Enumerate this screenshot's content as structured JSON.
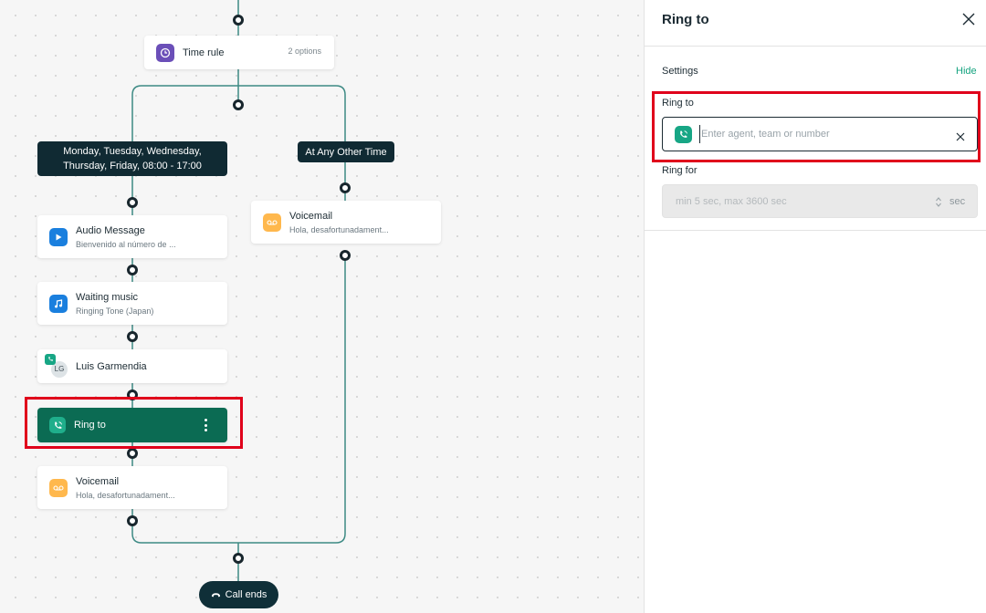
{
  "flow": {
    "time_rule": {
      "title": "Time rule",
      "meta": "2 options"
    },
    "branches": [
      {
        "label_line1": "Monday, Tuesday, Wednesday,",
        "label_line2": "Thursday, Friday, 08:00 - 17:00"
      },
      {
        "label": "At Any Other Time"
      }
    ],
    "steps": [
      {
        "title": "Audio Message",
        "subtitle": "Bienvenido al número de ...",
        "icon": "play-icon",
        "color": "#1a7fde"
      },
      {
        "title": "Waiting music",
        "subtitle": "Ringing Tone (Japan)",
        "icon": "music-note-icon",
        "color": "#1a7fde"
      },
      {
        "title": "Luis Garmendia",
        "avatar": "LG",
        "icon": "phone-icon"
      },
      {
        "title": "Ring to",
        "icon": "phone-ring-icon",
        "selected": true
      },
      {
        "title": "Voicemail",
        "subtitle": "Hola, desafortunadament...",
        "icon": "voicemail-icon",
        "color": "#ffb84d"
      }
    ],
    "other_time_step": {
      "title": "Voicemail",
      "subtitle": "Hola, desafortunadament...",
      "icon": "voicemail-icon"
    },
    "call_ends": "Call ends"
  },
  "panel": {
    "title": "Ring to",
    "settings_label": "Settings",
    "hide_label": "Hide",
    "ring_to": {
      "label": "Ring to",
      "placeholder": "Enter agent, team or number",
      "value": ""
    },
    "ring_for": {
      "label": "Ring for",
      "placeholder": "min 5 sec, max 3600 sec",
      "unit": "sec"
    }
  },
  "colors": {
    "accent": "#14a37f",
    "selected": "#0b6b53",
    "dark": "#102a33",
    "highlight": "#e0001b"
  }
}
